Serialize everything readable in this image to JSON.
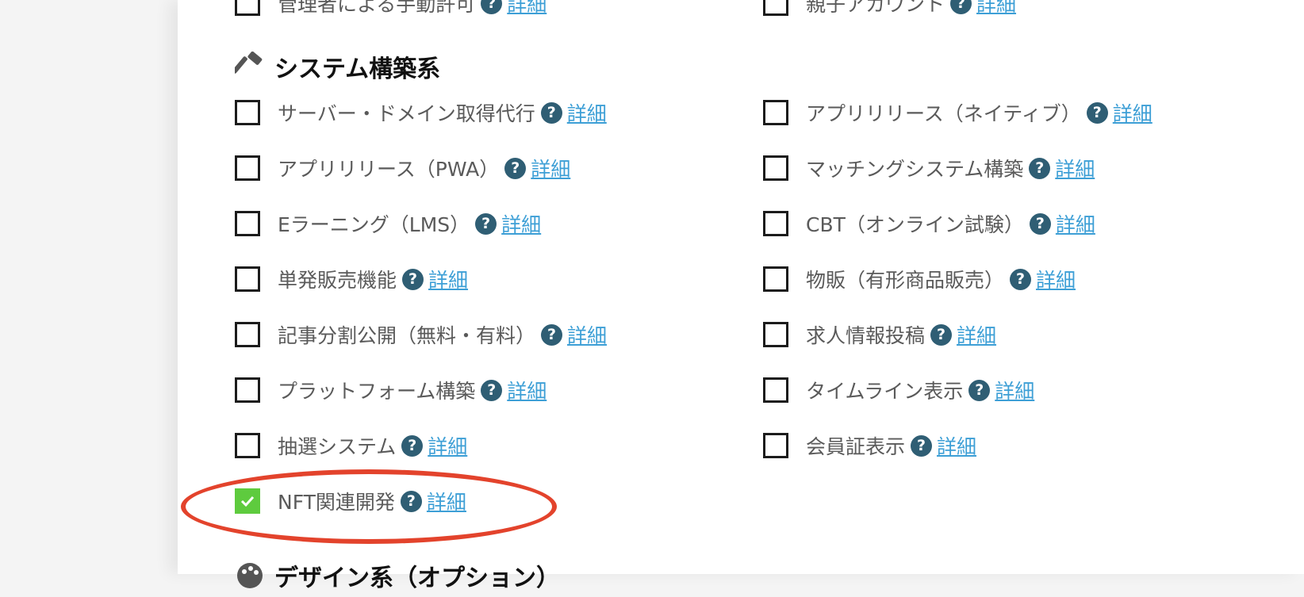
{
  "top_partial": {
    "left_label": "管理者による手動許可",
    "right_label": "親子アカウント",
    "detail_label": "詳細"
  },
  "section_system": {
    "title": "システム構築系",
    "icon": "hammer-icon"
  },
  "help_glyph": "?",
  "detail_label": "詳細",
  "options_left": [
    {
      "label": "サーバー・ドメイン取得代行",
      "checked": false
    },
    {
      "label": "アプリリリース（PWA）",
      "checked": false
    },
    {
      "label": "Eラーニング（LMS）",
      "checked": false
    },
    {
      "label": "単発販売機能",
      "checked": false
    },
    {
      "label": "記事分割公開（無料・有料）",
      "checked": false
    },
    {
      "label": "プラットフォーム構築",
      "checked": false
    },
    {
      "label": "抽選システム",
      "checked": false
    },
    {
      "label": "NFT関連開発",
      "checked": true
    }
  ],
  "options_right": [
    {
      "label": "アプリリリース（ネイティブ）",
      "checked": false
    },
    {
      "label": "マッチングシステム構築",
      "checked": false
    },
    {
      "label": "CBT（オンライン試験）",
      "checked": false
    },
    {
      "label": "物販（有形商品販売）",
      "checked": false
    },
    {
      "label": "求人情報投稿",
      "checked": false
    },
    {
      "label": "タイムライン表示",
      "checked": false
    },
    {
      "label": "会員証表示",
      "checked": false
    }
  ],
  "section_design": {
    "title": "デザイン系（オプション）",
    "icon": "palette-icon"
  },
  "colors": {
    "checked": "#5ecb3e",
    "help_icon": "#2f5e74",
    "link": "#3d9fd6",
    "highlight_circle": "#e3432c"
  }
}
